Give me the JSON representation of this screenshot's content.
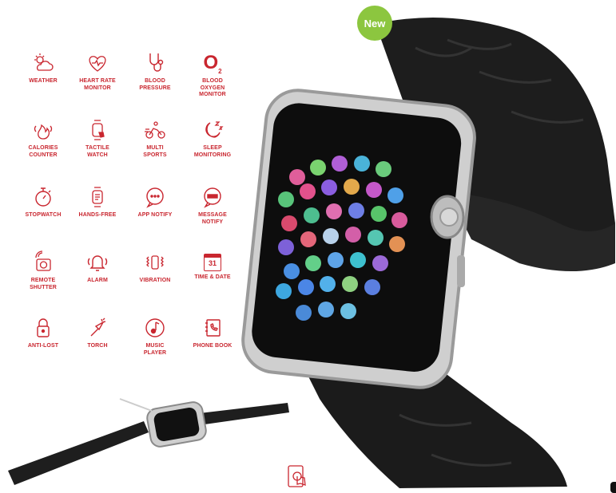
{
  "badge": {
    "label": "New"
  },
  "features": [
    {
      "label": "WEATHER",
      "icon": "weather-icon"
    },
    {
      "label": "HEART RATE\nMONITOR",
      "icon": "heart-rate-icon"
    },
    {
      "label": "BLOOD\nPRESSURE",
      "icon": "stethoscope-icon"
    },
    {
      "label": "BLOOD\nOXYGEN\nMONITOR",
      "icon": "oxygen-icon"
    },
    {
      "label": "CALORIES\nCOUNTER",
      "icon": "flame-icon"
    },
    {
      "label": "TACTILE\nWATCH",
      "icon": "touch-watch-icon"
    },
    {
      "label": "MULTI\nSPORTS",
      "icon": "cyclist-icon"
    },
    {
      "label": "SLEEP\nMONITORING",
      "icon": "moon-icon"
    },
    {
      "label": "STOPWATCH",
      "icon": "stopwatch-icon"
    },
    {
      "label": "HANDS-FREE",
      "icon": "watch-icon"
    },
    {
      "label": "APP NOTIFY",
      "icon": "chat-bubble-icon"
    },
    {
      "label": "MESSAGE\nNOTIFY",
      "icon": "message-icon"
    },
    {
      "label": "REMOTE\nSHUTTER",
      "icon": "camera-icon"
    },
    {
      "label": "ALARM",
      "icon": "bell-icon"
    },
    {
      "label": "VIBRATION",
      "icon": "vibration-icon"
    },
    {
      "label": "TIME & DATE",
      "icon": "calendar-icon"
    },
    {
      "label": "ANTI-LOST",
      "icon": "lock-icon"
    },
    {
      "label": "TORCH",
      "icon": "torch-icon"
    },
    {
      "label": "MUSIC\nPLAYER",
      "icon": "music-icon"
    },
    {
      "label": "PHONE BOOK",
      "icon": "phonebook-icon"
    }
  ],
  "calendar_day": "31",
  "oxygen_symbol": "O",
  "oxygen_sub": "2",
  "colors": {
    "accent": "#c9262f",
    "badge": "#8cc63f",
    "strap": "#1b1b1b",
    "frame": "#c8c8c8"
  }
}
